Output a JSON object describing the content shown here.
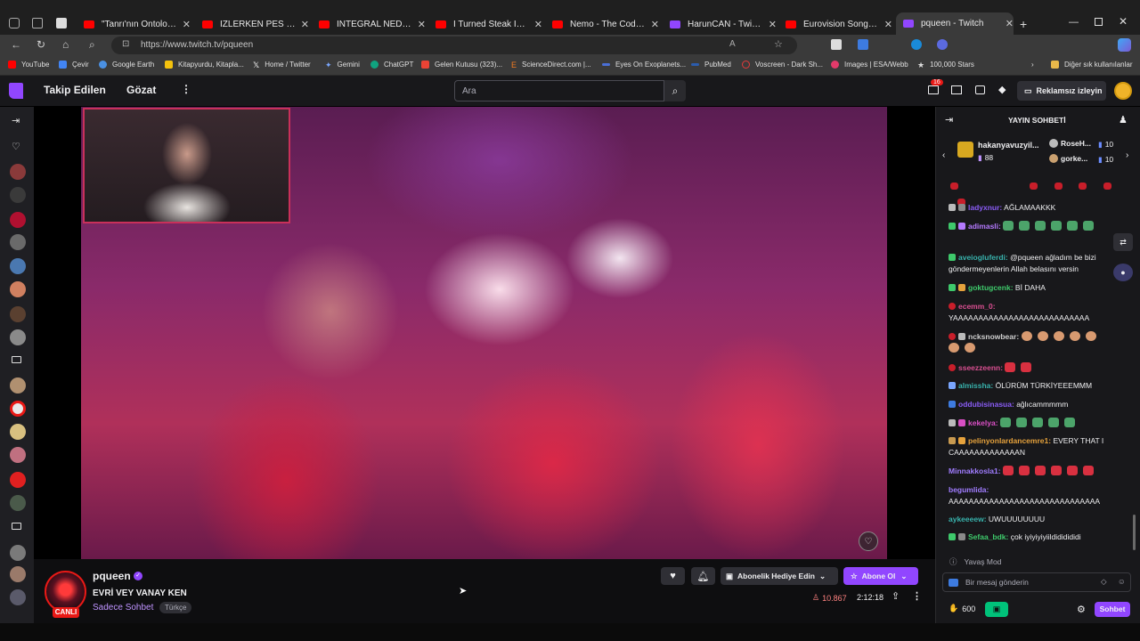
{
  "browser": {
    "tabs": [
      {
        "label": "\"Tanrı'nın Ontolojik Kanıt",
        "color": "#ff0000"
      },
      {
        "label": "İZLERKEN PES DİYECEĞİ",
        "color": "#ff0000"
      },
      {
        "label": "İNTEGRAL NEDİR? - YouT",
        "color": "#ff0000"
      },
      {
        "label": "I Turned Steak Into Bread",
        "color": "#ff0000"
      },
      {
        "label": "Nemo - The Code | Switz",
        "color": "#ff0000"
      },
      {
        "label": "HarunCAN - Twitch",
        "color": "#9146ff"
      },
      {
        "label": "Eurovision Song Contest",
        "color": "#ff0000"
      },
      {
        "label": "pqueen - Twitch",
        "color": "#9146ff"
      }
    ],
    "url": "https://www.twitch.tv/pqueen",
    "bookmarks": [
      {
        "label": "YouTube",
        "color": "#ff0000"
      },
      {
        "label": "Çevir",
        "color": "#4285f4"
      },
      {
        "label": "Google Earth",
        "color": "#4a90e2"
      },
      {
        "label": "Kitapyurdu, Kitapla...",
        "color": "#f4c20d"
      },
      {
        "label": "Home / Twitter",
        "color": "#e0e0e0"
      },
      {
        "label": "Gemini",
        "color": "#7aa7ff"
      },
      {
        "label": "ChatGPT",
        "color": "#10a37f"
      },
      {
        "label": "Gelen Kutusu (323)...",
        "color": "#ea4335"
      },
      {
        "label": "ScienceDirect.com |...",
        "color": "#f47b20"
      },
      {
        "label": "Eyes On Exoplanets...",
        "color": "#4a6fd6"
      },
      {
        "label": "PubMed",
        "color": "#2b5cad"
      },
      {
        "label": "Voscreen - Dark Sh...",
        "color": "#e23a3a"
      },
      {
        "label": "Images | ESA/Webb",
        "color": "#e23a6a"
      },
      {
        "label": "100,000 Stars",
        "color": "#333333"
      }
    ],
    "other_bookmarks": "Diğer sık kullanılanlar"
  },
  "twitch_nav": {
    "following": "Takip Edilen",
    "browse": "Gözat",
    "search_placeholder": "Ara",
    "notif_count": "16",
    "ad_free": "Reklamsız izleyin"
  },
  "stream": {
    "channel": "pqueen",
    "title": "EVRİ VEY VANAY KEN",
    "category": "Sadece Sohbet",
    "tag": "Türkçe",
    "live": "CANLI",
    "gift_sub": "Abonelik Hediye Edin",
    "subscribe": "Abone Ol",
    "viewers": "10.867",
    "uptime": "2:12:18"
  },
  "chat": {
    "header": "YAYIN SOHBETİ",
    "leaderboard": {
      "top_user": "hakanyavuzyil...",
      "top_count": "88",
      "second_user": "RoseH...",
      "second_count": "10",
      "third_user": "gorke...",
      "third_count": "10"
    },
    "messages": [
      {
        "user": "ladyxnur:",
        "text": "AĞLAMAAKKK",
        "color": "#8a5cf6"
      },
      {
        "user": "adimasli:",
        "text": "",
        "color": "#b57aff"
      },
      {
        "user": "aveiogluferdi:",
        "text": "@pqueen ağladım be bizi göndermeyenlerin Allah belasını versin",
        "color": "#38b2ac"
      },
      {
        "user": "goktugcenk:",
        "text": "Bİ DAHA",
        "color": "#3ec96b"
      },
      {
        "user": "ecemm_0:",
        "text": "YAAAAAAAAAAAAAAAAAAAAAAAAAAA",
        "color": "#d94f91"
      },
      {
        "user": "ncksnowbear:",
        "text": "",
        "color": "#cfcfcf"
      },
      {
        "user": "sseezzeenn:",
        "text": "",
        "color": "#d94f91"
      },
      {
        "user": "almissha:",
        "text": "ÖLÜRÜM TÜRKİYEEEMMM",
        "color": "#38b2ac"
      },
      {
        "user": "oddubisinasua:",
        "text": "ağlıcammmmm",
        "color": "#8a5cf6"
      },
      {
        "user": "kekelya:",
        "text": "",
        "color": "#d94fc4"
      },
      {
        "user": "pelinyonlardancemre1:",
        "text": "EVERY THAT I CAAAAAAAAAAAAAN",
        "color": "#e6a23c"
      },
      {
        "user": "Minnakkosla1:",
        "text": "",
        "color": "#a07cff"
      },
      {
        "user": "begumlida:",
        "text": "AAAAAAAAAAAAAAAAAAAAAAAAAAAAAA",
        "color": "#a07cff"
      },
      {
        "user": "aykeeeew:",
        "text": "UWUUUUUUUU",
        "color": "#38b2ac"
      },
      {
        "user": "Sefaa_bdk:",
        "text": "çok iyiyiyiyiildididididi",
        "color": "#3ec96b"
      }
    ],
    "slow_mode": "Yavaş Mod",
    "input_placeholder": "Bir mesaj gönderin",
    "points": "600",
    "send": "Sohbet"
  }
}
